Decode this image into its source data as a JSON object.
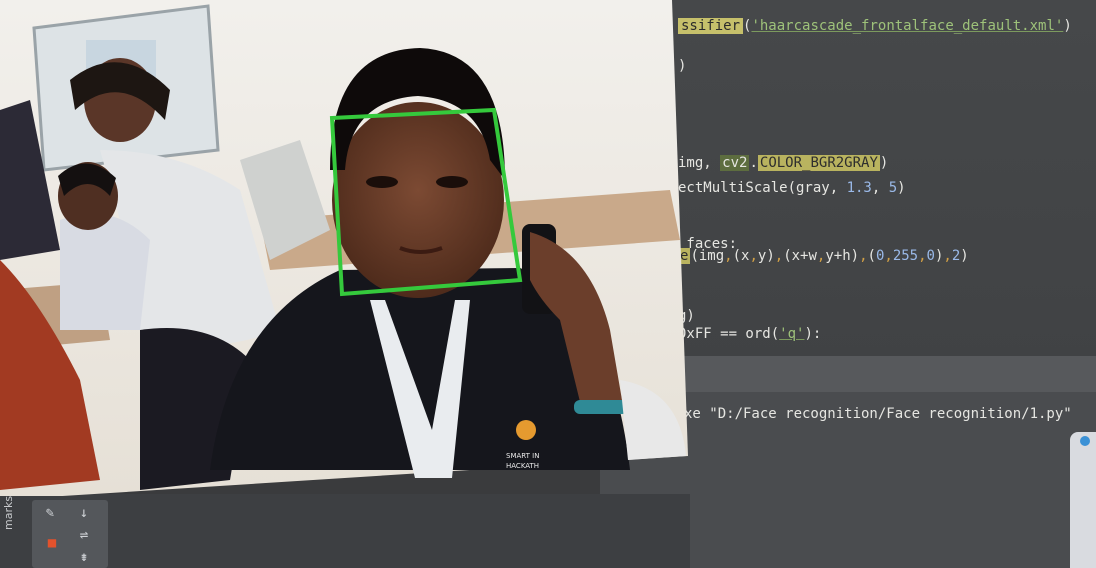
{
  "editor": {
    "lines": [
      {
        "id": "l1",
        "segments": [
          {
            "t": "ssifier",
            "c": "hl-yellow"
          },
          {
            "t": "(",
            "c": ""
          },
          {
            "t": "'haarcascade_frontalface_default.xml'",
            "c": "str"
          },
          {
            "t": ")",
            "c": ""
          }
        ]
      },
      {
        "id": "l2",
        "segments": [
          {
            "t": ")",
            "c": ""
          }
        ]
      },
      {
        "id": "l3",
        "segments": [
          {
            "t": "img, ",
            "c": ""
          },
          {
            "t": "cv2",
            "c": "hl-green"
          },
          {
            "t": ".",
            "c": ""
          },
          {
            "t": "COLOR_BGR2GRAY",
            "c": "hl-yellow2"
          },
          {
            "t": ")",
            "c": ""
          }
        ]
      },
      {
        "id": "l4",
        "segments": [
          {
            "t": "ectMultiScale(gray, ",
            "c": ""
          },
          {
            "t": "1.3",
            "c": "num"
          },
          {
            "t": ", ",
            "c": ""
          },
          {
            "t": "5",
            "c": "num"
          },
          {
            "t": ")",
            "c": ""
          }
        ]
      },
      {
        "id": "l5",
        "segments": [
          {
            "t": " faces:",
            "c": ""
          }
        ]
      },
      {
        "id": "l6",
        "segments": [
          {
            "t": "e",
            "c": "hl-yellow2"
          },
          {
            "t": "(img",
            "c": ""
          },
          {
            "t": ",",
            "c": "comma"
          },
          {
            "t": "(x",
            "c": ""
          },
          {
            "t": ",",
            "c": "comma"
          },
          {
            "t": "y)",
            "c": ""
          },
          {
            "t": ",",
            "c": "comma"
          },
          {
            "t": "(x+w",
            "c": ""
          },
          {
            "t": ",",
            "c": "comma"
          },
          {
            "t": "y+h)",
            "c": ""
          },
          {
            "t": ",",
            "c": "comma"
          },
          {
            "t": "(",
            "c": ""
          },
          {
            "t": "0",
            "c": "num"
          },
          {
            "t": ",",
            "c": "comma"
          },
          {
            "t": "255",
            "c": "num"
          },
          {
            "t": ",",
            "c": "comma"
          },
          {
            "t": "0",
            "c": "num"
          },
          {
            "t": ")",
            "c": ""
          },
          {
            "t": ",",
            "c": "comma"
          },
          {
            "t": "2",
            "c": "num"
          },
          {
            "t": ")",
            "c": ""
          }
        ]
      },
      {
        "id": "l7",
        "segments": [
          {
            "t": "g)",
            "c": ""
          }
        ]
      },
      {
        "id": "l8",
        "segments": [
          {
            "t": "0xFF == ord(",
            "c": ""
          },
          {
            "t": "'q'",
            "c": "str"
          },
          {
            "t": "):",
            "c": ""
          }
        ]
      }
    ]
  },
  "terminal": {
    "command": "xe \"D:/Face recognition/Face recognition/1.py\""
  },
  "toolbar": {
    "side_label": "marks",
    "icons": [
      "wrench-icon",
      "arrow-down-icon",
      "stop-icon",
      "wrap-icon",
      "scroll-end-icon"
    ]
  },
  "camera": {
    "detection_color": "#35c93c",
    "badge_text": "SMART IN\nHACKATH"
  }
}
